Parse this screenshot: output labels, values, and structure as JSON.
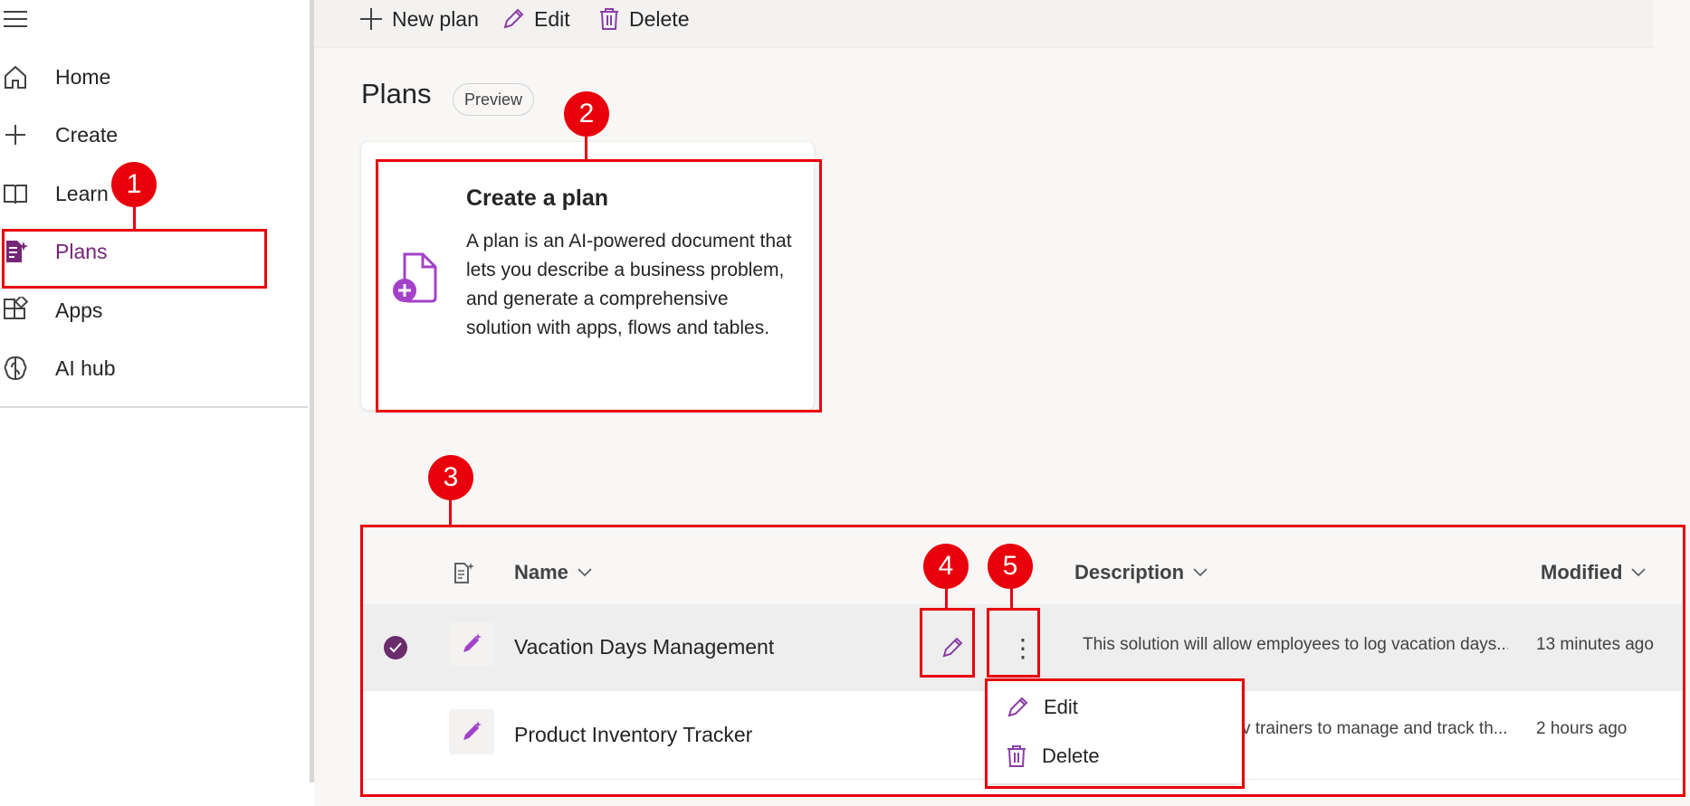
{
  "toolbar": {
    "new_plan": "New plan",
    "edit": "Edit",
    "delete": "Delete"
  },
  "sidebar": {
    "items": [
      {
        "label": "Home",
        "icon": "home-icon"
      },
      {
        "label": "Create",
        "icon": "plus-icon"
      },
      {
        "label": "Learn",
        "icon": "book-icon"
      },
      {
        "label": "Plans",
        "icon": "plans-icon",
        "active": true
      },
      {
        "label": "Apps",
        "icon": "apps-icon"
      },
      {
        "label": "AI hub",
        "icon": "ai-hub-icon"
      }
    ]
  },
  "page": {
    "title": "Plans",
    "badge": "Preview"
  },
  "create_card": {
    "title": "Create a plan",
    "description": "A plan is an AI-powered document that lets you describe a business problem, and generate a comprehensive solution with apps, flows and tables."
  },
  "grid": {
    "columns": {
      "name": "Name",
      "description": "Description",
      "modified": "Modified"
    },
    "rows": [
      {
        "name": "Vacation Days Management",
        "description": "This solution will allow employees to log vacation days...",
        "modified": "13 minutes ago",
        "selected": true
      },
      {
        "name": "Product Inventory Tracker",
        "description": "v trainers to manage and track th...",
        "modified": "2 hours ago",
        "selected": false
      }
    ]
  },
  "context_menu": {
    "edit": "Edit",
    "delete": "Delete"
  },
  "callouts": [
    "1",
    "2",
    "3",
    "4",
    "5"
  ],
  "colors": {
    "accent": "#742774",
    "callout": "#e8000b",
    "icon_purple": "#a342c9"
  }
}
